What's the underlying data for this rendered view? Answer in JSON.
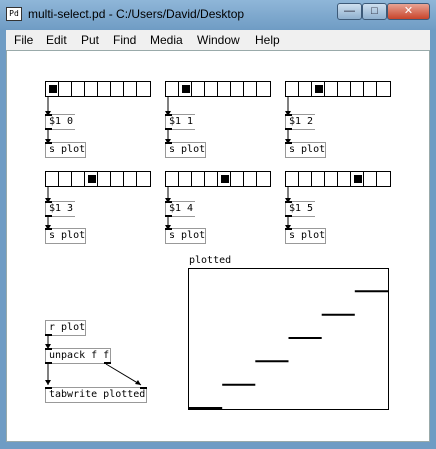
{
  "window": {
    "icon_text": "Pd",
    "title": "multi-select.pd  - C:/Users/David/Desktop",
    "min_glyph": "—",
    "max_glyph": "□",
    "close_glyph": "✕"
  },
  "menu": [
    "File",
    "Edit",
    "Put",
    "Find",
    "Media",
    "Window",
    "Help"
  ],
  "patch": {
    "radios": [
      {
        "cells": 8,
        "selected": 0
      },
      {
        "cells": 8,
        "selected": 1
      },
      {
        "cells": 8,
        "selected": 2
      },
      {
        "cells": 8,
        "selected": 3
      },
      {
        "cells": 8,
        "selected": 4
      },
      {
        "cells": 8,
        "selected": 5
      }
    ],
    "messages": [
      "$1 0",
      "$1 1",
      "$1 2",
      "$1 3",
      "$1 4",
      "$1 5"
    ],
    "send_objects": [
      "s plot",
      "s plot",
      "s plot",
      "s plot",
      "s plot",
      "s plot"
    ],
    "receive_object": "r plot",
    "unpack_object": "unpack f f",
    "tabwrite_object": "tabwrite plotted",
    "graph": {
      "name": "plotted",
      "values": [
        0,
        1,
        2,
        3,
        4,
        5
      ],
      "ylim": [
        0,
        6
      ]
    }
  }
}
